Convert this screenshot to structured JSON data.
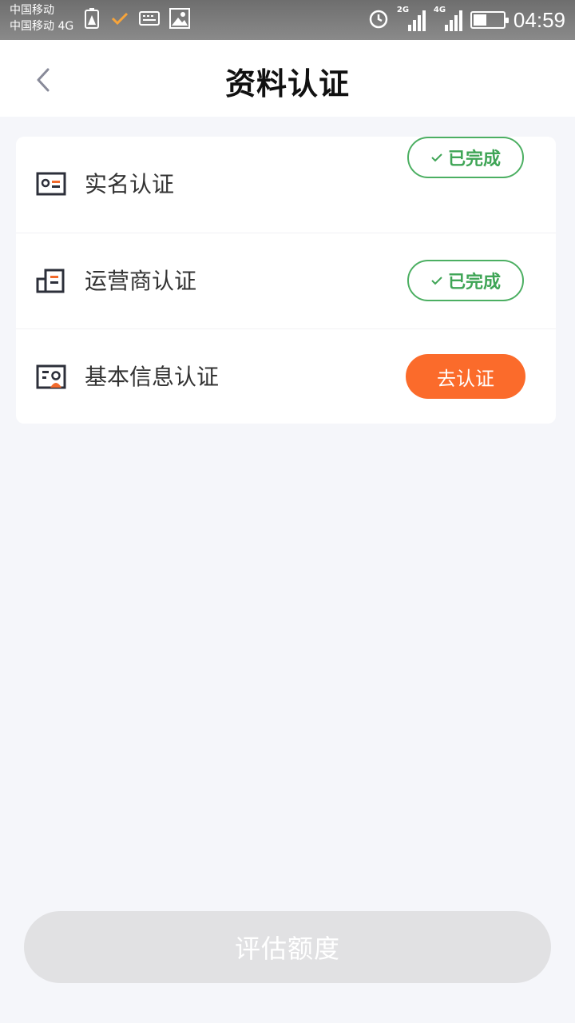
{
  "status_bar": {
    "carrier_line1": "中国移动",
    "carrier_line2": "中国移动 4G",
    "net1": "2G",
    "net2": "4G",
    "time": "04:59",
    "battery_level": 0.45,
    "icons": [
      "battery-warning-icon",
      "check-icon",
      "keyboard-icon",
      "image-icon",
      "alarm-icon",
      "signal-icon",
      "battery-icon"
    ]
  },
  "nav": {
    "title": "资料认证",
    "back_icon": "chevron-left-icon"
  },
  "items": [
    {
      "label": "实名认证",
      "status": "已完成",
      "icon": "id-card-icon"
    },
    {
      "label": "运营商认证",
      "status": "已完成",
      "icon": "operator-icon"
    },
    {
      "label": "基本信息认证",
      "action": "去认证",
      "icon": "profile-card-icon"
    }
  ],
  "bottom_button": {
    "label": "评估额度"
  },
  "colors": {
    "accent_orange": "#fb6b2b",
    "done_green": "#4caf62",
    "background": "#f5f6fa",
    "disabled_button": "#e1e1e3"
  }
}
